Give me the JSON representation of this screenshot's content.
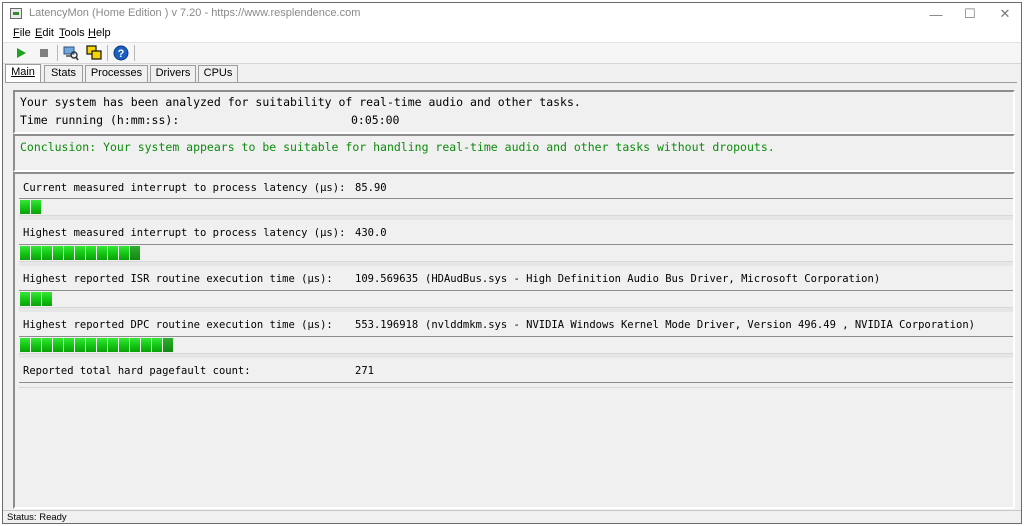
{
  "window": {
    "title": "LatencyMon  (Home Edition )  v 7.20 - https://www.resplendence.com",
    "minimize": "—",
    "maximize": "☐",
    "close": "✕"
  },
  "menu": [
    {
      "label": "File",
      "underline": "F",
      "rest": "ile"
    },
    {
      "label": "Edit",
      "underline": "E",
      "rest": "dit"
    },
    {
      "label": "Tools",
      "underline": "T",
      "rest": "ools"
    },
    {
      "label": "Help",
      "underline": "H",
      "rest": "elp"
    }
  ],
  "toolbar": {
    "icons": [
      "play-icon",
      "stop-icon",
      "computer-search-icon",
      "windows-icon",
      "help-icon"
    ],
    "colors": {
      "play": "#1fa31f",
      "stop": "#808080",
      "help": "#1a5fc2"
    }
  },
  "tabs": [
    {
      "label": "Main",
      "active": true
    },
    {
      "label": "Stats",
      "active": false
    },
    {
      "label": "Processes",
      "active": false
    },
    {
      "label": "Drivers",
      "active": false
    },
    {
      "label": "CPUs",
      "active": false
    }
  ],
  "info": {
    "summary": "Your system has been analyzed for suitability of real-time audio and other tasks.",
    "time_label": "Time running (h:mm:ss):",
    "time_value": "0:05:00"
  },
  "conclusion": "Conclusion: Your system appears to be suitable for handling real-time audio and other tasks without dropouts.",
  "metrics": [
    {
      "label": "Current measured interrupt to process latency (µs):",
      "value": "85.90",
      "detail": "",
      "segments": 2
    },
    {
      "label": "Highest measured interrupt to process latency (µs):",
      "value": "430.0",
      "detail": "",
      "segments": 11
    },
    {
      "label": "Highest reported ISR routine execution time (µs):",
      "value": "109.569635",
      "detail": "(HDAudBus.sys - High Definition Audio Bus Driver, Microsoft Corporation)",
      "segments": 3
    },
    {
      "label": "Highest reported DPC routine execution time (µs):",
      "value": "553.196918",
      "detail": "(nvlddmkm.sys - NVIDIA Windows Kernel Mode Driver, Version 496.49 , NVIDIA Corporation)",
      "segments": 14
    },
    {
      "label": "Reported total hard pagefault count:",
      "value": "271",
      "detail": "",
      "segments": 0
    }
  ],
  "status": "Status: Ready",
  "colors": {
    "conclusion": "#0e8a0e",
    "bar_green": "#14c914"
  }
}
